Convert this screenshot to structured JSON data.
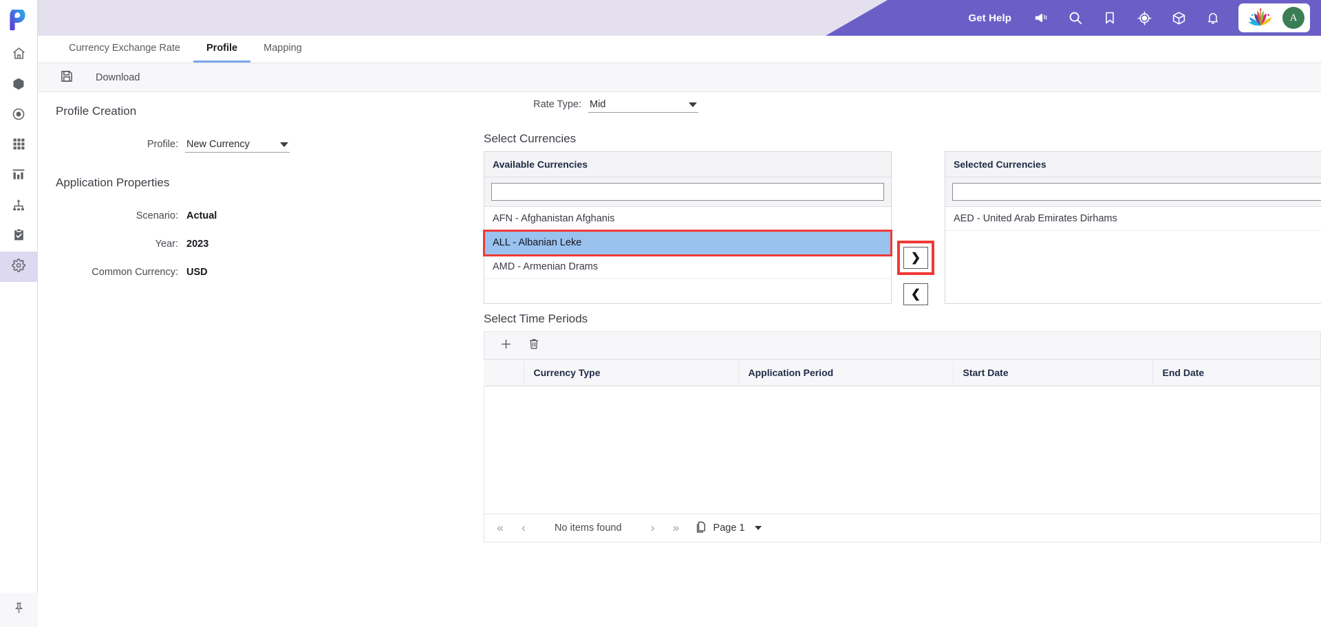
{
  "header": {
    "get_help": "Get Help",
    "icons": [
      "announcement-icon",
      "search-icon",
      "bookmark-icon",
      "navigator-icon",
      "cube-icon",
      "bell-icon"
    ],
    "avatar_initial": "A",
    "accent_color": "#6b5fc7",
    "header_band_color": "#e4e0ee"
  },
  "sidebar": {
    "items": [
      {
        "name": "home",
        "icon": "home-icon"
      },
      {
        "name": "cube",
        "icon": "cube-icon"
      },
      {
        "name": "target",
        "icon": "target-icon"
      },
      {
        "name": "grid",
        "icon": "grid-icon"
      },
      {
        "name": "reports",
        "icon": "bar-chart-icon"
      },
      {
        "name": "hierarchy",
        "icon": "hierarchy-icon"
      },
      {
        "name": "tasks",
        "icon": "clipboard-check-icon"
      },
      {
        "name": "settings",
        "icon": "gear-icon",
        "active": true
      }
    ],
    "pin": {
      "name": "pin",
      "icon": "pin-icon"
    }
  },
  "tabs": [
    {
      "label": "Currency Exchange Rate",
      "active": false
    },
    {
      "label": "Profile",
      "active": true
    },
    {
      "label": "Mapping",
      "active": false
    }
  ],
  "toolbar": {
    "save_icon": "save-icon",
    "download_label": "Download"
  },
  "left_form": {
    "profile_creation_title": "Profile Creation",
    "profile_label": "Profile:",
    "profile_value": "New Currency",
    "application_properties_title": "Application Properties",
    "properties": [
      {
        "label": "Scenario:",
        "value": "Actual"
      },
      {
        "label": "Year:",
        "value": "2023"
      },
      {
        "label": "Common Currency:",
        "value": "USD"
      }
    ]
  },
  "rate_type": {
    "label": "Rate Type:",
    "value": "Mid"
  },
  "currencies": {
    "section_title": "Select Currencies",
    "available": {
      "header": "Available Currencies",
      "search_value": "",
      "search_placeholder": "",
      "items": [
        {
          "label": "AFN - Afghanistan Afghanis",
          "selected": false
        },
        {
          "label": "ALL - Albanian Leke",
          "selected": true
        },
        {
          "label": "AMD - Armenian Drams",
          "selected": false
        }
      ]
    },
    "selected": {
      "header": "Selected Currencies",
      "search_value": "",
      "search_placeholder": "",
      "items": [
        {
          "label": "AED - United Arab Emirates Dirhams",
          "selected": false
        }
      ]
    },
    "move_right_label": "❯",
    "move_left_label": "❮",
    "highlight_color": "#ef3a36",
    "selection_color": "#99c2ef"
  },
  "time_periods": {
    "section_title": "Select Time Periods",
    "add_icon": "plus-icon",
    "delete_icon": "trash-icon",
    "columns": [
      "",
      "Currency Type",
      "Application Period",
      "Start Date",
      "End Date"
    ],
    "rows": [],
    "pager": {
      "first_label": "«",
      "prev_label": "‹",
      "status": "No items found",
      "next_label": "›",
      "last_label": "»",
      "page_icon": "pages-icon",
      "page_label": "Page 1"
    }
  }
}
